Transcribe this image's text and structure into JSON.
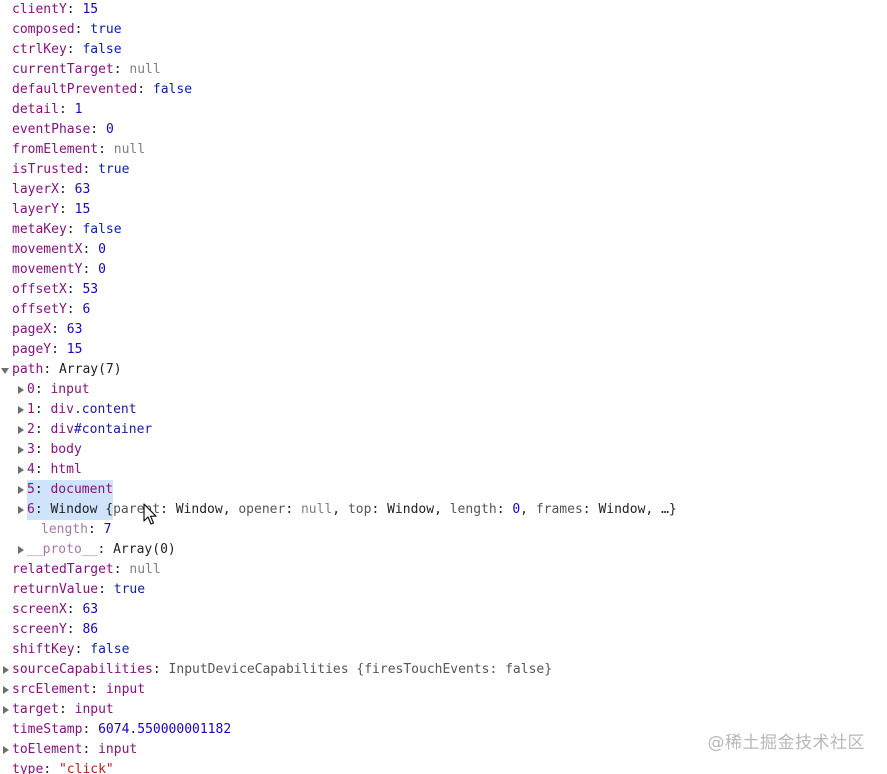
{
  "properties_top": [
    {
      "key": "clientY",
      "value": "15",
      "type": "num"
    },
    {
      "key": "composed",
      "value": "true",
      "type": "bool"
    },
    {
      "key": "ctrlKey",
      "value": "false",
      "type": "bool"
    },
    {
      "key": "currentTarget",
      "value": "null",
      "type": "null"
    },
    {
      "key": "defaultPrevented",
      "value": "false",
      "type": "bool"
    },
    {
      "key": "detail",
      "value": "1",
      "type": "num"
    },
    {
      "key": "eventPhase",
      "value": "0",
      "type": "num"
    },
    {
      "key": "fromElement",
      "value": "null",
      "type": "null"
    },
    {
      "key": "isTrusted",
      "value": "true",
      "type": "bool"
    },
    {
      "key": "layerX",
      "value": "63",
      "type": "num"
    },
    {
      "key": "layerY",
      "value": "15",
      "type": "num"
    },
    {
      "key": "metaKey",
      "value": "false",
      "type": "bool"
    },
    {
      "key": "movementX",
      "value": "0",
      "type": "num"
    },
    {
      "key": "movementY",
      "value": "0",
      "type": "num"
    },
    {
      "key": "offsetX",
      "value": "53",
      "type": "num"
    },
    {
      "key": "offsetY",
      "value": "6",
      "type": "num"
    },
    {
      "key": "pageX",
      "value": "63",
      "type": "num"
    },
    {
      "key": "pageY",
      "value": "15",
      "type": "num"
    }
  ],
  "path": {
    "key": "path",
    "value": "Array(7)",
    "items": [
      {
        "index": "0",
        "label": "input",
        "cls": ""
      },
      {
        "index": "1",
        "label": "div",
        "cls": ".content"
      },
      {
        "index": "2",
        "label": "div",
        "cls": "#container"
      },
      {
        "index": "3",
        "label": "body",
        "cls": ""
      },
      {
        "index": "4",
        "label": "html",
        "cls": ""
      },
      {
        "index": "5",
        "label": "document",
        "cls": ""
      }
    ],
    "window_item": {
      "index": "6",
      "label": "Window",
      "preview_open": " {",
      "preview_parts": [
        {
          "k": "parent",
          "v": "Window",
          "t": "obj"
        },
        {
          "k": "opener",
          "v": "null",
          "t": "null"
        },
        {
          "k": "top",
          "v": "Window",
          "t": "obj"
        },
        {
          "k": "length",
          "v": "0",
          "t": "num"
        },
        {
          "k": "frames",
          "v": "Window",
          "t": "obj"
        }
      ],
      "preview_close": ", …}"
    },
    "length_key": "length",
    "length_value": "7",
    "proto_key": "__proto__",
    "proto_value": "Array(0)"
  },
  "properties_bottom": [
    {
      "key": "relatedTarget",
      "value": "null",
      "type": "null",
      "caret": false
    },
    {
      "key": "returnValue",
      "value": "true",
      "type": "bool",
      "caret": false
    },
    {
      "key": "screenX",
      "value": "63",
      "type": "num",
      "caret": false
    },
    {
      "key": "screenY",
      "value": "86",
      "type": "num",
      "caret": false
    },
    {
      "key": "shiftKey",
      "value": "false",
      "type": "bool",
      "caret": false
    },
    {
      "key": "sourceCapabilities",
      "value": "InputDeviceCapabilities {firesTouchEvents: false}",
      "type": "obj",
      "caret": true
    },
    {
      "key": "srcElement",
      "value": "input",
      "type": "node",
      "caret": true
    },
    {
      "key": "target",
      "value": "input",
      "type": "node",
      "caret": true
    },
    {
      "key": "timeStamp",
      "value": "6074.550000001182",
      "type": "num",
      "caret": false
    },
    {
      "key": "toElement",
      "value": "input",
      "type": "node",
      "caret": true
    },
    {
      "key": "type",
      "value": "\"click\"",
      "type": "str",
      "caret": false
    }
  ],
  "watermark": "@稀土掘金技术社区",
  "colors": {
    "key": "#881280",
    "number": "#1c00cf",
    "boolean": "#0d22aa",
    "null": "#808080",
    "string": "#c41a16",
    "selection": "#cfe3fb"
  }
}
